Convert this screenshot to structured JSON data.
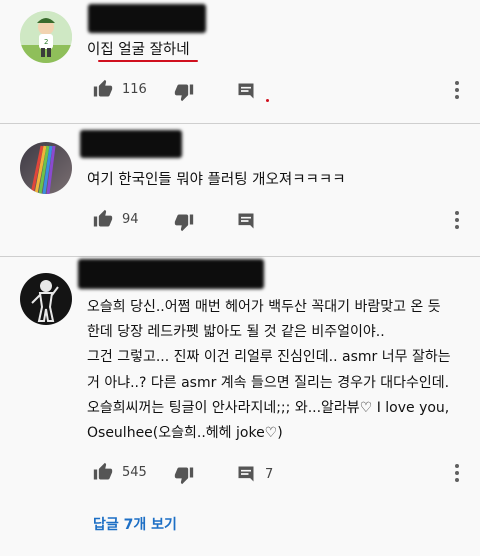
{
  "comments": [
    {
      "username": "",
      "text_lines": [
        "이집 얼굴 잘하네"
      ],
      "likes": "116",
      "reply_count": ""
    },
    {
      "username": "",
      "text_lines": [
        "여기 한국인들 뭐야 플러팅 개오져ㅋㅋㅋㅋ"
      ],
      "likes": "94",
      "reply_count": ""
    },
    {
      "username": "",
      "text_lines": [
        "오슬희 당신..어쩜 매번 헤어가 백두산 꼭대기 바람맞고 온 듯",
        "한데 당장 레드카펫 밟아도 될 것 같은 비주얼이야..",
        "그건 그렇고... 진짜 이건 리얼루 진심인데.. asmr 너무 잘하는",
        "거 아냐..? 다른 asmr 계속 들으면 질리는 경우가 대다수인데.",
        "오슬희씨꺼는 팅글이 안사라지네;;; 와...알라뷰♡ I love you,",
        "Oseulhee(오슬희..헤헤 joke♡)"
      ],
      "likes": "545",
      "reply_count": "7"
    }
  ],
  "view_replies_label": "답글 7개 보기",
  "colors": {
    "accent_link": "#1d6fc5",
    "underline": "#d0101e",
    "icon": "#555555",
    "background": "#f9f9f9"
  },
  "icons": [
    "thumbs-up-icon",
    "thumbs-down-icon",
    "reply-icon",
    "more-vert-icon"
  ]
}
